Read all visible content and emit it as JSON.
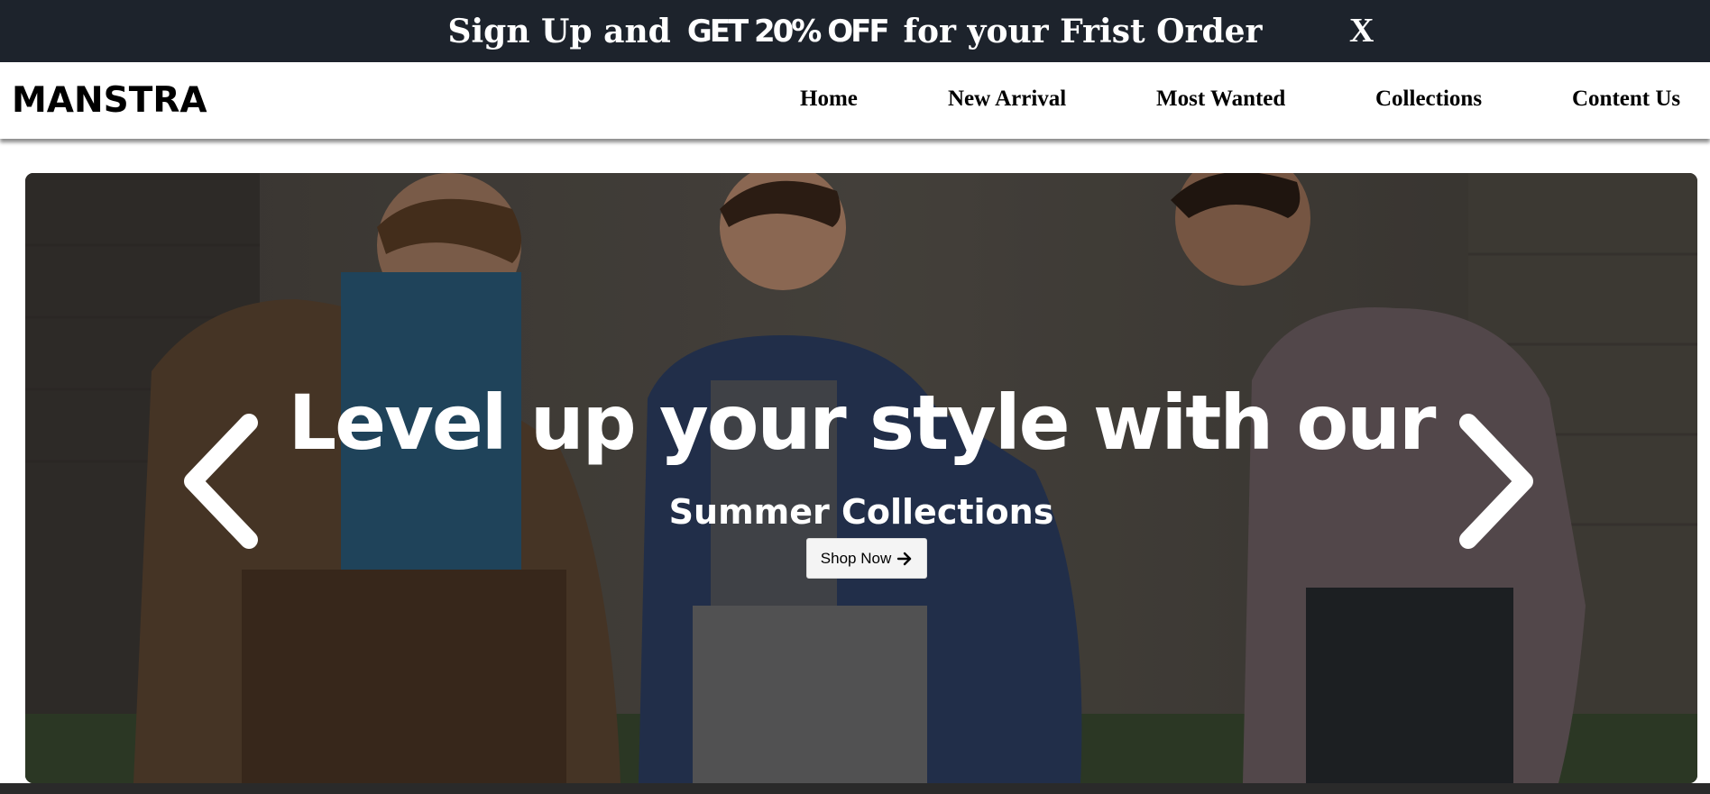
{
  "promo": {
    "text_before": "Sign Up and",
    "highlight": "GET 20% OFF",
    "text_after": "for your Frist Order",
    "close_label": "X"
  },
  "header": {
    "logo": "MANSTRA",
    "nav": [
      {
        "label": "Home"
      },
      {
        "label": "New Arrival"
      },
      {
        "label": "Most Wanted"
      },
      {
        "label": "Collections"
      },
      {
        "label": "Content Us"
      }
    ]
  },
  "hero": {
    "title": "Level up your style with our",
    "subtitle": "Summer Collections",
    "cta_label": "Shop Now",
    "cta_icon": "arrow-right-icon",
    "prev_icon": "chevron-left-icon",
    "next_icon": "chevron-right-icon"
  },
  "colors": {
    "promo_bg": "#1d232c",
    "text_white": "#ffffff",
    "text_black": "#000000"
  }
}
